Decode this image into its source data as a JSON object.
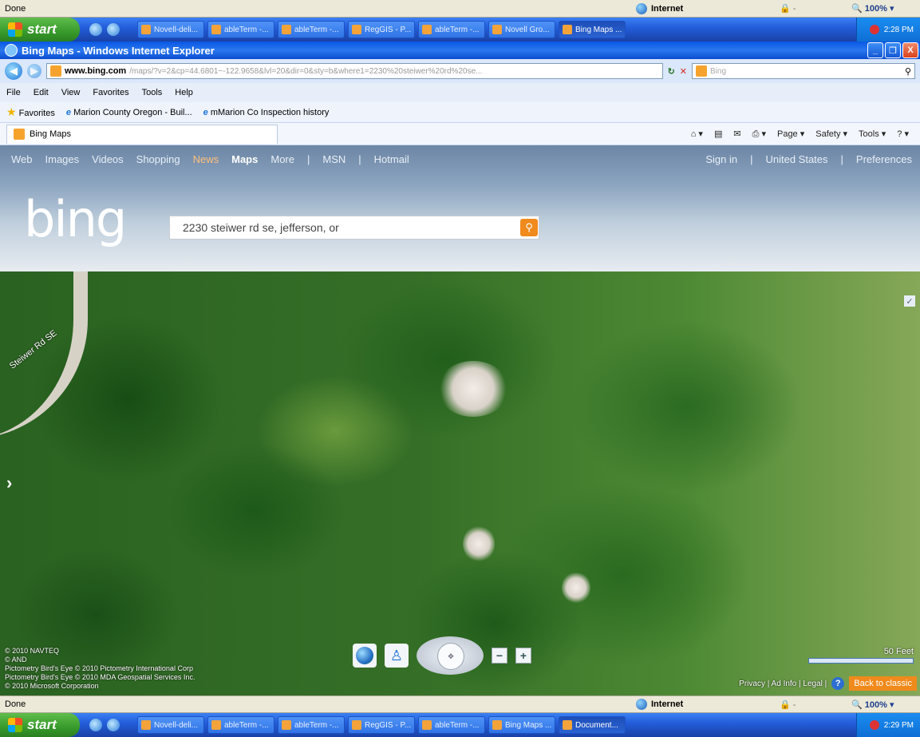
{
  "top_status": {
    "text": "Done",
    "zone": "Internet",
    "protected": "🔒 -",
    "zoom": "🔍 100%  ▾"
  },
  "top_taskbar": {
    "start": "start",
    "tasks": [
      "Novell-deli...",
      "ableTerm -...",
      "ableTerm -...",
      "RegGIS - P...",
      "ableTerm -...",
      "Novell Gro...",
      "Bing Maps ..."
    ],
    "active_index": 6,
    "clock": "2:28 PM"
  },
  "ie": {
    "title": "Bing Maps - Windows Internet Explorer",
    "window_buttons": [
      "_",
      "❐",
      "X"
    ],
    "url_host": "www.bing.com",
    "url_rest": "/maps/?v=2&cp=44.6801~-122.9658&lvl=20&dir=0&sty=b&where1=2230%20steiwer%20rd%20se...",
    "search_placeholder": "Bing",
    "menu": [
      "File",
      "Edit",
      "View",
      "Favorites",
      "Tools",
      "Help"
    ],
    "favorites": {
      "label": "Favorites",
      "items": [
        "Marion County Oregon - Buil...",
        "mMarion Co Inspection history"
      ]
    },
    "tab_title": "Bing Maps",
    "commands": [
      "Page ▾",
      "Safety ▾",
      "Tools ▾",
      "? ▾"
    ]
  },
  "bing": {
    "nav_left": [
      "Web",
      "Images",
      "Videos",
      "Shopping",
      "News",
      "Maps",
      "More",
      "|",
      "MSN",
      "|",
      "Hotmail"
    ],
    "nav_right": [
      "Sign in",
      "|",
      "United States",
      "|",
      "Preferences"
    ],
    "logo": "bing",
    "query": "2230 steiwer rd se, jefferson, or"
  },
  "map": {
    "road_label": "Steiwer Rd SE",
    "attribution": [
      "© 2010 NAVTEQ",
      "© AND",
      "Pictometry Bird's Eye © 2010 Pictometry International Corp",
      "Pictometry Bird's Eye © 2010 MDA Geospatial Services Inc.",
      "© 2010 Microsoft Corporation"
    ],
    "scale_label": "50 Feet",
    "footer": "Privacy | Ad Info | Legal |",
    "back_to_classic": "Back to classic"
  },
  "bottom_status": {
    "text": "Done",
    "zone": "Internet",
    "protected": "🔒 -",
    "zoom": "🔍 100%  ▾"
  },
  "bottom_taskbar": {
    "start": "start",
    "tasks": [
      "Novell-deli...",
      "ableTerm -...",
      "ableTerm -...",
      "RegGIS - P...",
      "ableTerm -...",
      "Bing Maps ...",
      "Document..."
    ],
    "active_index": 6,
    "clock": "2:29 PM"
  },
  "colors": {
    "bing_orange": "#f08a1c",
    "xp_blue": "#245edb",
    "start_green": "#379a2b"
  }
}
